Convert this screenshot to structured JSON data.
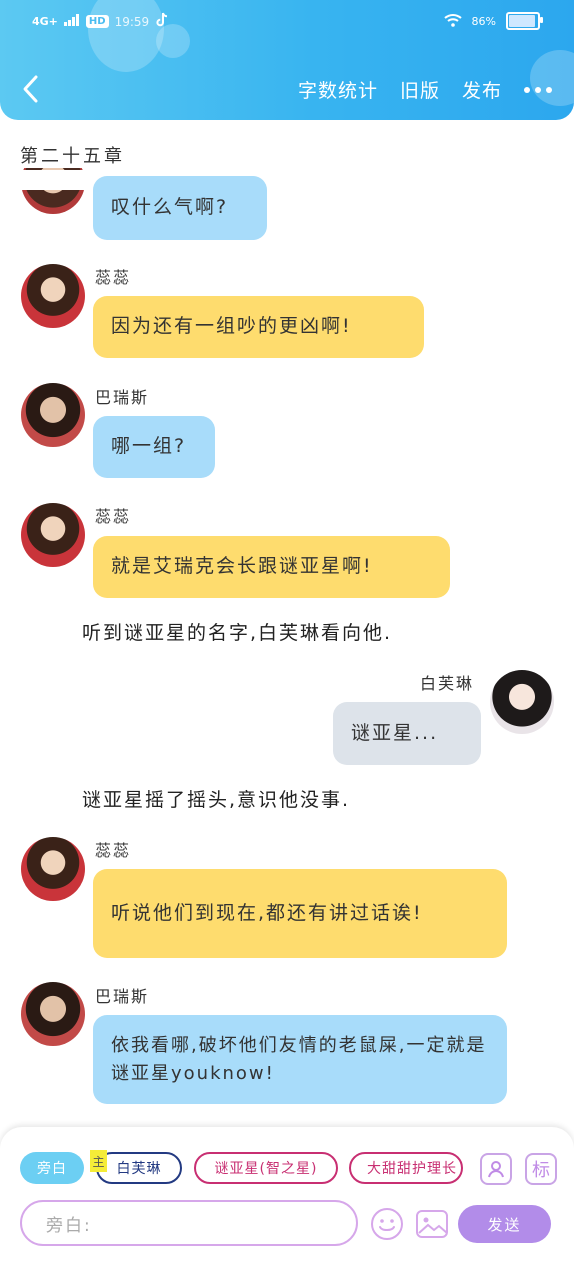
{
  "status_bar": {
    "network": "4G+",
    "hd": "HD",
    "time": "19:59",
    "battery": "86%"
  },
  "header": {
    "word_count": "字数统计",
    "old_version": "旧版",
    "publish": "发布"
  },
  "chapter_title": "第二十五章",
  "messages": [
    {
      "text": "叹什么气啊?"
    },
    {
      "name": "蕊蕊",
      "text": "因为还有一组吵的更凶啊!"
    },
    {
      "name": "巴瑞斯",
      "text": "哪一组?"
    },
    {
      "name": "蕊蕊",
      "text": "就是艾瑞克会长跟谜亚星啊!"
    },
    {
      "name": "白芙琳",
      "text": "谜亚星..."
    },
    {
      "name": "蕊蕊",
      "text": "听说他们到现在,都还有讲过话诶!"
    },
    {
      "name": "巴瑞斯",
      "text": "依我看哪,破坏他们友情的老鼠屎,一定就是谜亚星youknow!"
    }
  ],
  "narration": [
    "听到谜亚星的名字,白芙琳看向他.",
    "谜亚星摇了摇头,意识他没事."
  ],
  "composer": {
    "chips": [
      "旁白",
      "白芙琳",
      "谜亚星(智之星)",
      "大甜甜护理长"
    ],
    "main_tag": "主",
    "input_placeholder": "旁白:",
    "send_label": "发送",
    "mark_label": "标"
  },
  "colors": {
    "header": "#38b4f0",
    "blue_bubble": "#a8dcfa",
    "yellow_bubble": "#fedc6e",
    "gray_bubble": "#dde3ea",
    "send": "#b28ce9"
  }
}
